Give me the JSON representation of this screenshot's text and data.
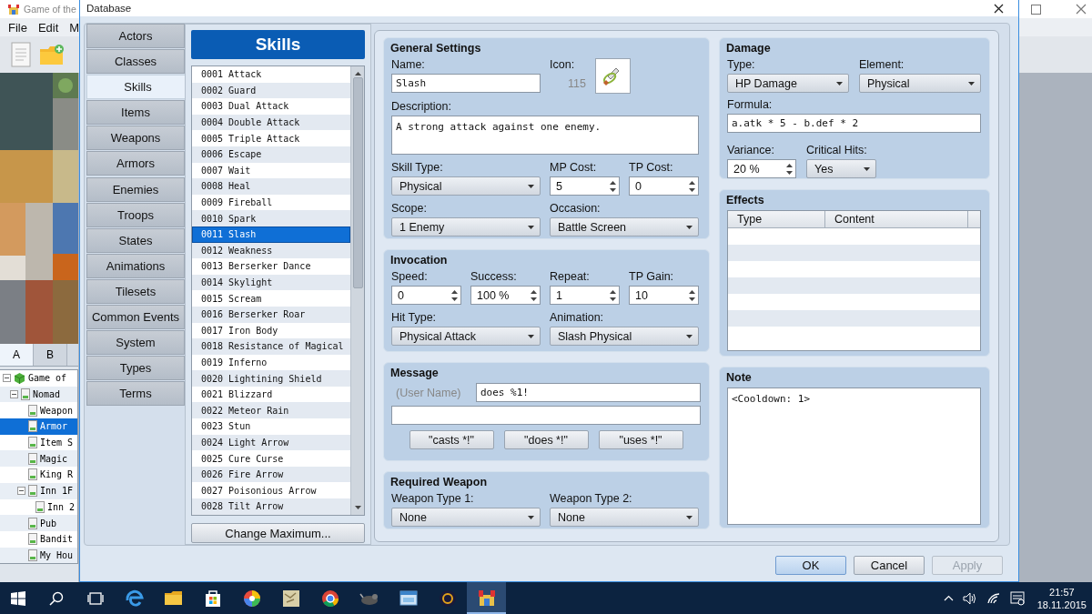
{
  "background_window": {
    "title": "Game of the",
    "menu": [
      "File",
      "Edit",
      "M"
    ],
    "tileset_tabs": [
      {
        "label": "A",
        "selected": true
      },
      {
        "label": "B",
        "selected": false
      }
    ],
    "map_tree": [
      {
        "label": "Game of",
        "kind": "project",
        "expanded": true,
        "selected": false,
        "children": [
          {
            "label": "Nomad",
            "kind": "map",
            "expanded": true,
            "selected": false,
            "children": [
              {
                "label": "Weapon",
                "kind": "map",
                "selected": false
              },
              {
                "label": "Armor",
                "kind": "map",
                "selected": true
              },
              {
                "label": "Item S",
                "kind": "map",
                "selected": false
              },
              {
                "label": "Magic",
                "kind": "map",
                "selected": false
              },
              {
                "label": "King R",
                "kind": "map",
                "selected": false
              },
              {
                "label": "Inn 1F",
                "kind": "map",
                "expanded": true,
                "selected": false,
                "children": [
                  {
                    "label": "Inn 2",
                    "kind": "map",
                    "selected": false
                  }
                ]
              },
              {
                "label": "Pub",
                "kind": "map",
                "selected": false
              },
              {
                "label": "Bandit",
                "kind": "map",
                "selected": false
              },
              {
                "label": "My Hou",
                "kind": "map",
                "selected": false
              }
            ]
          }
        ]
      }
    ]
  },
  "dialog": {
    "title": "Database",
    "categories": [
      {
        "label": "Actors",
        "selected": false
      },
      {
        "label": "Classes",
        "selected": false
      },
      {
        "label": "Skills",
        "selected": true
      },
      {
        "label": "Items",
        "selected": false
      },
      {
        "label": "Weapons",
        "selected": false
      },
      {
        "label": "Armors",
        "selected": false
      },
      {
        "label": "Enemies",
        "selected": false
      },
      {
        "label": "Troops",
        "selected": false
      },
      {
        "label": "States",
        "selected": false
      },
      {
        "label": "Animations",
        "selected": false
      },
      {
        "label": "Tilesets",
        "selected": false
      },
      {
        "label": "Common Events",
        "selected": false
      },
      {
        "label": "System",
        "selected": false
      },
      {
        "label": "Types",
        "selected": false
      },
      {
        "label": "Terms",
        "selected": false
      }
    ],
    "list_title": "Skills",
    "skills": [
      {
        "label": "0001 Attack",
        "selected": false
      },
      {
        "label": "0002 Guard",
        "selected": false
      },
      {
        "label": "0003 Dual Attack",
        "selected": false
      },
      {
        "label": "0004 Double Attack",
        "selected": false
      },
      {
        "label": "0005 Triple Attack",
        "selected": false
      },
      {
        "label": "0006 Escape",
        "selected": false
      },
      {
        "label": "0007 Wait",
        "selected": false
      },
      {
        "label": "0008 Heal",
        "selected": false
      },
      {
        "label": "0009 Fireball",
        "selected": false
      },
      {
        "label": "0010 Spark",
        "selected": false
      },
      {
        "label": "0011 Slash",
        "selected": true
      },
      {
        "label": "0012 Weakness",
        "selected": false
      },
      {
        "label": "0013 Berserker Dance",
        "selected": false
      },
      {
        "label": "0014 Skylight",
        "selected": false
      },
      {
        "label": "0015 Scream",
        "selected": false
      },
      {
        "label": "0016 Berserker Roar",
        "selected": false
      },
      {
        "label": "0017 Iron Body",
        "selected": false
      },
      {
        "label": "0018 Resistance of Magical",
        "selected": false
      },
      {
        "label": "0019 Inferno",
        "selected": false
      },
      {
        "label": "0020 Lightining Shield",
        "selected": false
      },
      {
        "label": "0021 Blizzard",
        "selected": false
      },
      {
        "label": "0022 Meteor Rain",
        "selected": false
      },
      {
        "label": "0023 Stun",
        "selected": false
      },
      {
        "label": "0024 Light Arrow",
        "selected": false
      },
      {
        "label": "0025 Cure Curse",
        "selected": false
      },
      {
        "label": "0026 Fire Arrow",
        "selected": false
      },
      {
        "label": "0027 Poisonious Arrow",
        "selected": false
      },
      {
        "label": "0028 Tilt Arrow",
        "selected": false
      }
    ],
    "change_maximum_button": "Change Maximum...",
    "general_settings": {
      "title": "General Settings",
      "name_label": "Name:",
      "name": "Slash",
      "icon_label": "Icon:",
      "icon_index": "115",
      "description_label": "Description:",
      "description": "A strong attack against one enemy.",
      "skill_type_label": "Skill Type:",
      "skill_type": "Physical",
      "mp_cost_label": "MP Cost:",
      "mp_cost": "5",
      "tp_cost_label": "TP Cost:",
      "tp_cost": "0",
      "scope_label": "Scope:",
      "scope": "1 Enemy",
      "occasion_label": "Occasion:",
      "occasion": "Battle Screen"
    },
    "invocation": {
      "title": "Invocation",
      "speed_label": "Speed:",
      "speed": "0",
      "success_label": "Success:",
      "success": "100 %",
      "repeat_label": "Repeat:",
      "repeat": "1",
      "tp_gain_label": "TP Gain:",
      "tp_gain": "10",
      "hit_type_label": "Hit Type:",
      "hit_type": "Physical Attack",
      "animation_label": "Animation:",
      "animation": "Slash Physical"
    },
    "message": {
      "title": "Message",
      "user_name_hint": "(User Name)",
      "line_1": "does %1!",
      "template_buttons": [
        "\"casts *!\"",
        "\"does *!\"",
        "\"uses *!\""
      ]
    },
    "required_weapon": {
      "title": "Required Weapon",
      "weapon_type_1_label": "Weapon Type 1:",
      "weapon_type_1": "None",
      "weapon_type_2_label": "Weapon Type 2:",
      "weapon_type_2": "None"
    },
    "damage": {
      "title": "Damage",
      "type_label": "Type:",
      "type": "HP Damage",
      "element_label": "Element:",
      "element": "Physical",
      "formula_label": "Formula:",
      "formula": "a.atk * 5 - b.def * 2",
      "variance_label": "Variance:",
      "variance": "20 %",
      "critical_hits_label": "Critical Hits:",
      "critical_hits": "Yes"
    },
    "effects": {
      "title": "Effects",
      "columns": [
        "Type",
        "Content"
      ]
    },
    "note": {
      "title": "Note",
      "text": "<Cooldown: 1>"
    },
    "buttons": [
      {
        "label": "OK",
        "kind": "default"
      },
      {
        "label": "Cancel",
        "kind": "normal"
      },
      {
        "label": "Apply",
        "kind": "disabled"
      }
    ]
  },
  "taskbar": {
    "apps": [
      {
        "selected": false
      },
      {
        "selected": false
      },
      {
        "selected": false
      },
      {
        "selected": false
      },
      {
        "selected": false
      },
      {
        "selected": false
      },
      {
        "selected": false
      },
      {
        "selected": false
      },
      {
        "selected": false
      },
      {
        "selected": true
      }
    ],
    "time": "21:57",
    "date": "18.11.2015"
  }
}
